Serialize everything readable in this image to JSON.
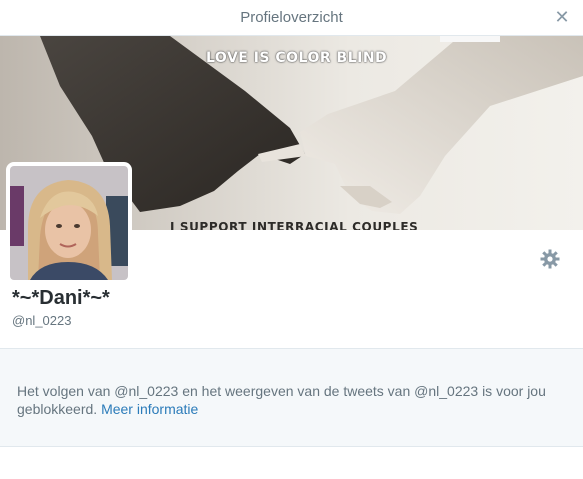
{
  "window": {
    "title": "Profieloverzicht",
    "close_icon": "close-icon"
  },
  "banner": {
    "headline": "LOVE IS COLOR BLIND",
    "caption": "I SUPPORT INTERRACIAL COUPLES"
  },
  "profile": {
    "display_name": "*~*Dani*~*",
    "handle": "@nl_0223",
    "settings_icon": "gear-icon"
  },
  "blocked_notice": {
    "text": "Het volgen van @nl_0223 en het weergeven van de tweets van @nl_0223 is voor jou geblokkeerd.",
    "link_label": "Meer informatie"
  },
  "colors": {
    "link": "#2b7bb9",
    "panel_bg": "#f5f8fa",
    "border": "#e1e8ed",
    "muted_text": "#66757f"
  }
}
